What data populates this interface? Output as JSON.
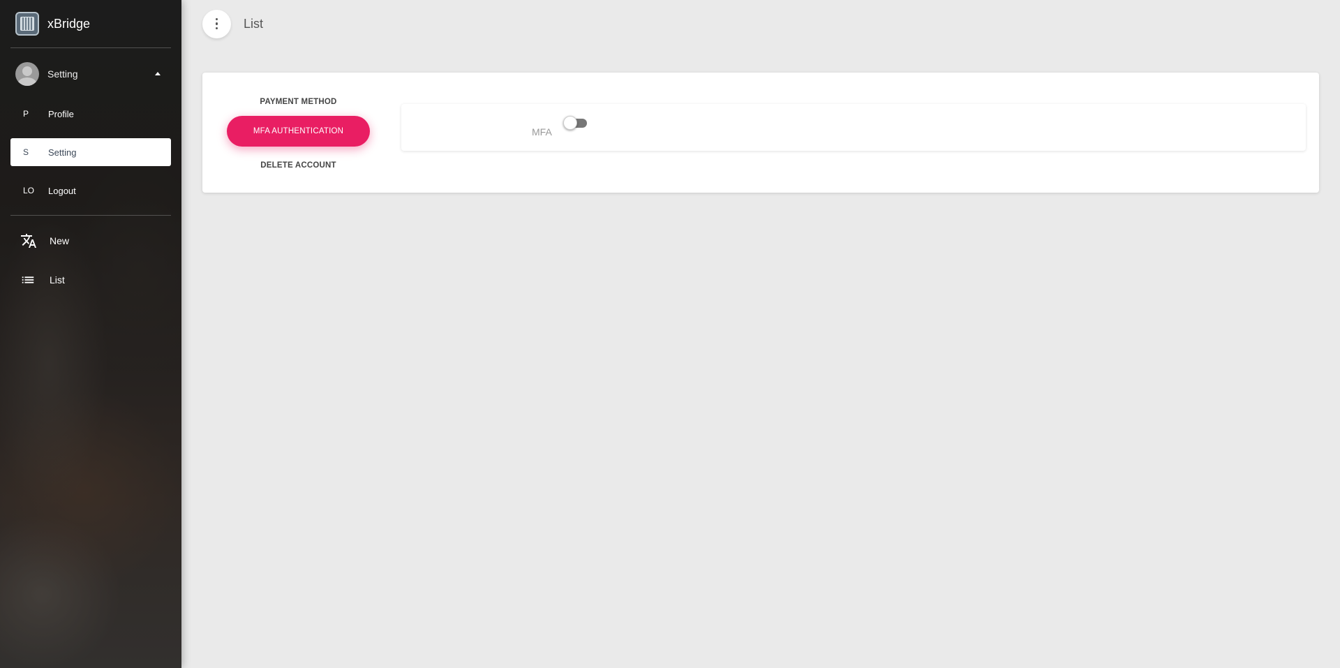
{
  "app": {
    "name": "xBridge"
  },
  "user": {
    "name": "Setting"
  },
  "user_menu": [
    {
      "abbr": "P",
      "label": "Profile"
    },
    {
      "abbr": "S",
      "label": "Setting"
    },
    {
      "abbr": "LO",
      "label": "Logout"
    }
  ],
  "nav": [
    {
      "icon": "translate-icon",
      "label": "New"
    },
    {
      "icon": "list-icon",
      "label": "List"
    }
  ],
  "header": {
    "title": "List",
    "menu_icon": "more-vert-icon"
  },
  "tabs": {
    "payment": "PAYMENT METHOD",
    "mfa": "MFA AUTHENTICATION",
    "delete": "DELETE ACCOUNT",
    "active": "MFA AUTHENTICATION"
  },
  "mfa_panel": {
    "label": "MFA",
    "enabled": false
  },
  "colors": {
    "accent": "#e91e63",
    "background": "#eaeaea"
  }
}
